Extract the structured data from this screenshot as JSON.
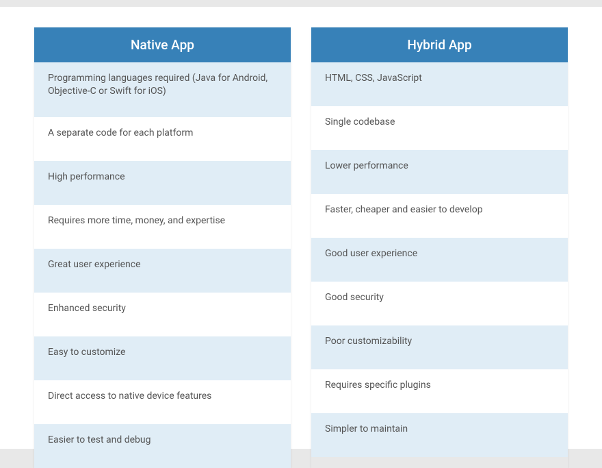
{
  "comparison": {
    "columns": [
      {
        "title": "Native App",
        "rows": [
          "Programming languages required (Java for Android, Objective-C or Swift for iOS)",
          "A separate code for each platform",
          "High performance",
          "Requires more time, money, and expertise",
          "Great user experience",
          "Enhanced security",
          "Easy to customize",
          "Direct access to native device features",
          "Easier to test and debug"
        ]
      },
      {
        "title": "Hybrid App",
        "rows": [
          "HTML, CSS, JavaScript",
          "Single codebase",
          "Lower performance",
          "Faster, cheaper and easier to develop",
          "Good user experience",
          "Good security",
          "Poor customizability",
          "Requires specific plugins",
          "Simpler to maintain"
        ]
      }
    ]
  }
}
